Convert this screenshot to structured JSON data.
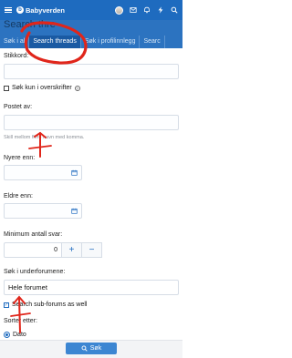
{
  "header": {
    "logo_text": "Babyverden",
    "icons": [
      "hamburger-icon",
      "flag-icon",
      "envelope-icon",
      "bell-icon",
      "lightning-icon",
      "search-icon"
    ],
    "brand_color": "#1e6bbf"
  },
  "page_title": "Search thre",
  "tabs": [
    {
      "label": "Søk i al"
    },
    {
      "label": "Search threads"
    },
    {
      "label": "Søk i profilinnlegg"
    },
    {
      "label": "Searc"
    }
  ],
  "form": {
    "keywords_label": "Stikkord:",
    "titles_only_label": "Søk kun i overskrifter",
    "posted_by_label": "Postet av:",
    "posted_by_hint": "Skill mellom flere navn med komma.",
    "newer_than_label": "Nyere enn:",
    "older_than_label": "Eldre enn:",
    "min_replies_label": "Minimum antall svar:",
    "min_replies_value": "0",
    "plus_label": "+",
    "minus_label": "−",
    "subforums_label": "Søk i underforumene:",
    "subforum_value": "Hele forumet",
    "search_subforums_label": "Search sub-forums as well",
    "sort_label": "Sorter etter:",
    "sort_option": "Dato"
  },
  "footer": {
    "search_button": "Søk"
  },
  "annotation_color": "#e0261b"
}
